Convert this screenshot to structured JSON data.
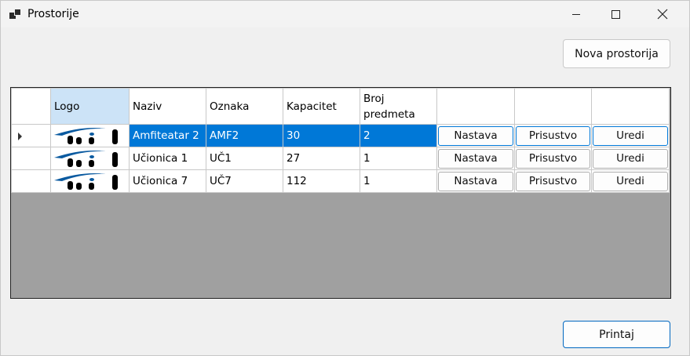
{
  "window": {
    "title": "Prostorije"
  },
  "buttons": {
    "new_room": "Nova prostorija",
    "print": "Printaj"
  },
  "table": {
    "headers": [
      "Logo",
      "Naziv",
      "Oznaka",
      "Kapacitet",
      "Broj predmeta"
    ],
    "rows": [
      {
        "naziv": "Amfiteatar 2",
        "oznaka": "AMF2",
        "kapacitet": "30",
        "broj_predmeta": "2",
        "selected": true
      },
      {
        "naziv": "Učionica 1",
        "oznaka": "UČ1",
        "kapacitet": "27",
        "broj_predmeta": "1",
        "selected": false
      },
      {
        "naziv": "Učionica 7",
        "oznaka": "UČ7",
        "kapacitet": "112",
        "broj_predmeta": "1",
        "selected": false
      }
    ],
    "row_buttons": {
      "nastava": "Nastava",
      "prisustvo": "Prisustvo",
      "uredi": "Uredi"
    }
  },
  "colors": {
    "selection": "#0078d7",
    "logo_blue": "#0a5aa0",
    "grid_background": "#a0a0a0"
  }
}
